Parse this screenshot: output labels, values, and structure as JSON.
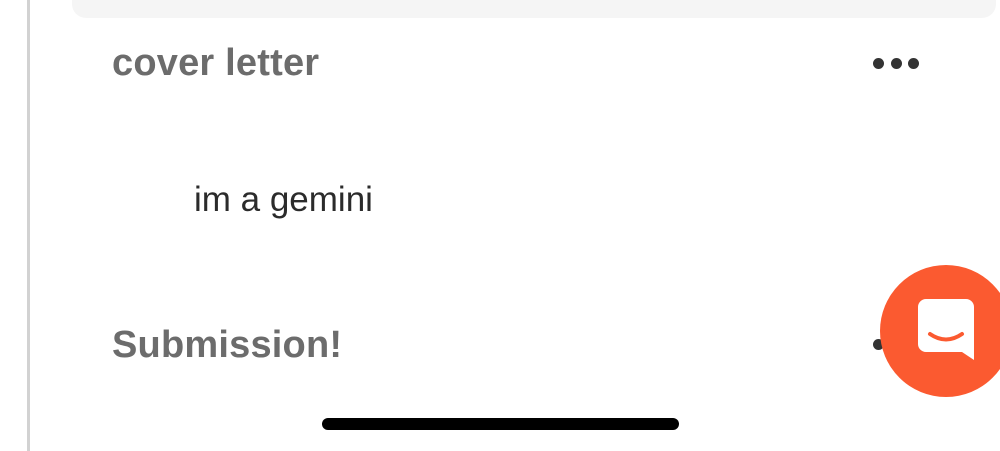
{
  "sections": [
    {
      "title": "cover letter",
      "more_icon": "more-horizontal-icon",
      "body": "im a gemini"
    },
    {
      "title": "Submission!",
      "more_icon": "more-horizontal-icon"
    }
  ],
  "chat_launcher": {
    "icon": "chat-bubble-smile-icon",
    "color": "#fb5a30"
  },
  "colors": {
    "title": "#6c6c6c",
    "body_text": "#2b2b2b",
    "card_background": "#f5f5f5",
    "divider": "#d2d2d2"
  }
}
